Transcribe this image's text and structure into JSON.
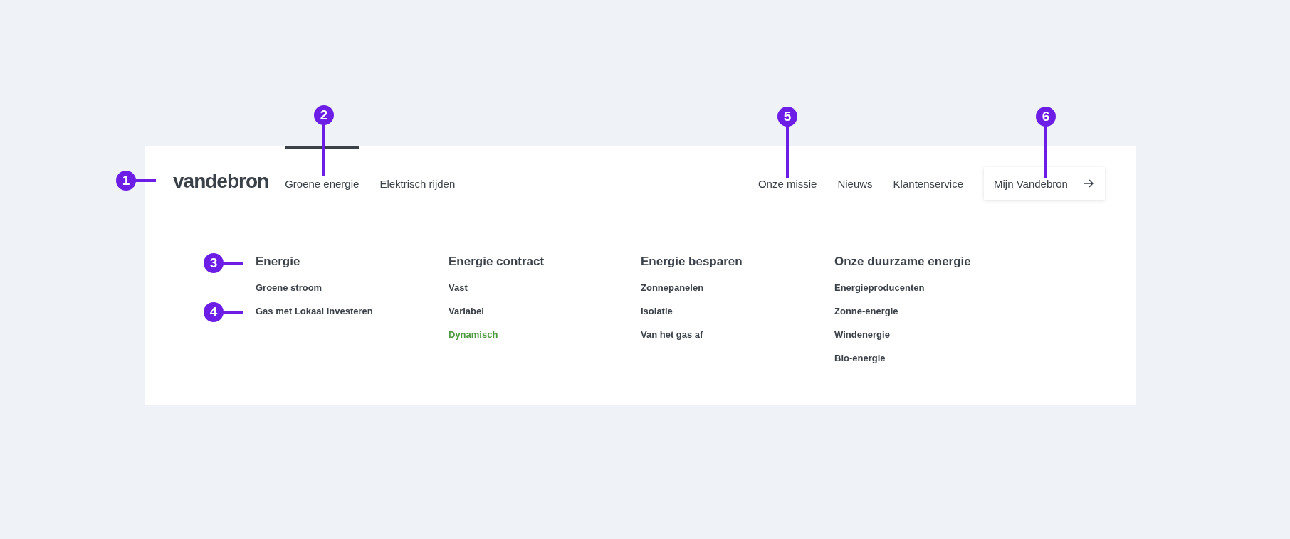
{
  "header": {
    "logo": "vandebron",
    "nav_left": [
      {
        "label": "Groene energie",
        "selected": true
      },
      {
        "label": "Elektrisch rijden",
        "selected": false
      }
    ],
    "nav_right": [
      "Onze missie",
      "Nieuws",
      "Klantenservice"
    ],
    "account_button": "Mijn Vandebron"
  },
  "menu": [
    {
      "heading": "Energie",
      "items": [
        {
          "label": "Groene stroom",
          "selected": false
        },
        {
          "label": "Gas met Lokaal investeren",
          "selected": false
        }
      ]
    },
    {
      "heading": "Energie contract",
      "items": [
        {
          "label": "Vast",
          "selected": false
        },
        {
          "label": "Variabel",
          "selected": false
        },
        {
          "label": "Dynamisch",
          "selected": true
        }
      ]
    },
    {
      "heading": "Energie besparen",
      "items": [
        {
          "label": "Zonnepanelen",
          "selected": false
        },
        {
          "label": "Isolatie",
          "selected": false
        },
        {
          "label": "Van het gas af",
          "selected": false
        }
      ]
    },
    {
      "heading": "Onze duurzame energie",
      "items": [
        {
          "label": "Energieproducenten",
          "selected": false
        },
        {
          "label": "Zonne-energie",
          "selected": false
        },
        {
          "label": "Windenergie",
          "selected": false
        },
        {
          "label": "Bio-energie",
          "selected": false
        }
      ]
    }
  ],
  "callouts": [
    {
      "number": "1",
      "kind": "side"
    },
    {
      "number": "2",
      "kind": "top"
    },
    {
      "number": "3",
      "kind": "side"
    },
    {
      "number": "4",
      "kind": "side"
    },
    {
      "number": "5",
      "kind": "top"
    },
    {
      "number": "6",
      "kind": "top"
    }
  ]
}
